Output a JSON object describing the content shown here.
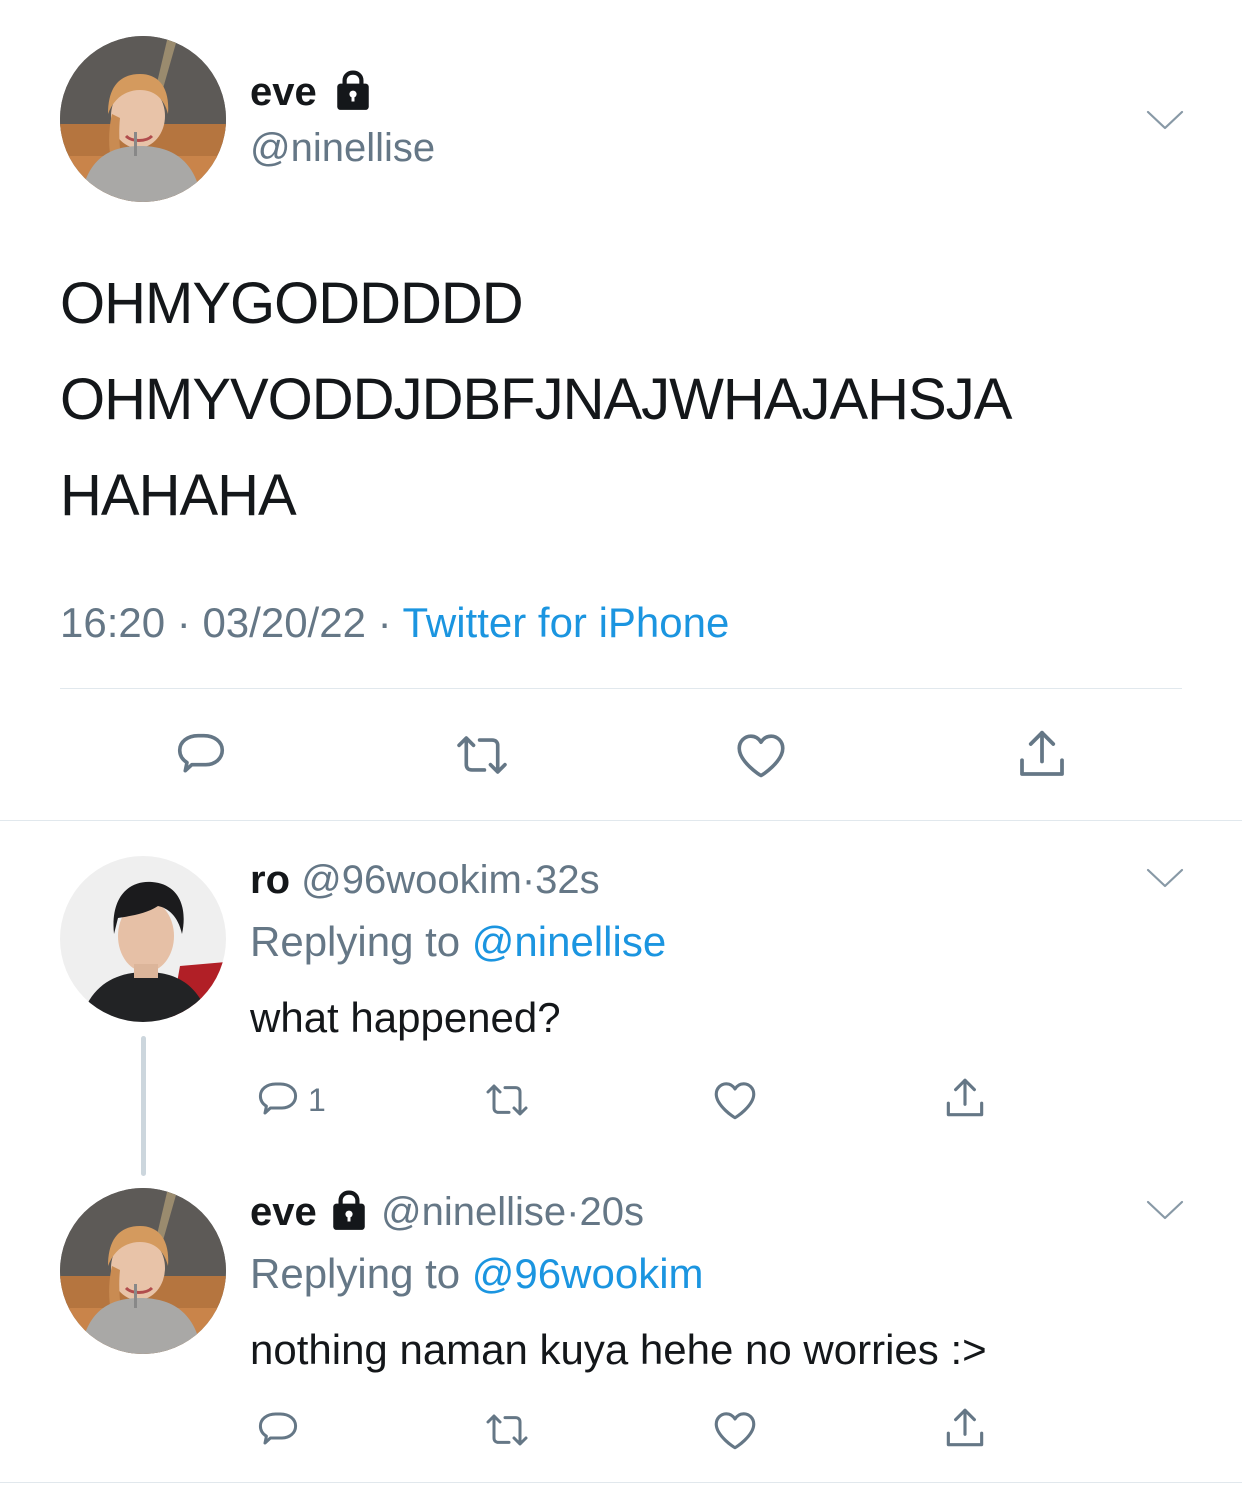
{
  "main_tweet": {
    "display_name": "eve",
    "handle": "@ninellise",
    "text_lines": [
      "OHMYGODDDDD",
      "OHMYVODDJDBFJNAJWHAJAHSJA",
      "HAHAHA"
    ],
    "time": "16:20",
    "date": "03/20/22",
    "separator": "·",
    "source": "Twitter for iPhone"
  },
  "replies": [
    {
      "display_name": "ro",
      "handle": "@96wookim",
      "dot": "·",
      "age": "32s",
      "replying_prefix": "Replying to",
      "replying_to": "@ninellise",
      "text": "what happened?",
      "reply_count": "1"
    },
    {
      "display_name": "eve",
      "handle": "@ninellise",
      "dot": "·",
      "age": "20s",
      "replying_prefix": "Replying to",
      "replying_to": "@96wookim",
      "text": "nothing naman kuya hehe no worries :>",
      "reply_count": ""
    }
  ],
  "icons": {
    "reply": "speech-bubble-icon",
    "retweet": "retweet-icon",
    "like": "heart-icon",
    "share": "share-icon",
    "menu": "chevron-down-icon",
    "protected": "lock-icon"
  },
  "colors": {
    "text": "#14171a",
    "muted": "#657786",
    "link": "#1b95e0",
    "divider": "#e1e8ed",
    "thread_line": "#ccd6dd"
  }
}
